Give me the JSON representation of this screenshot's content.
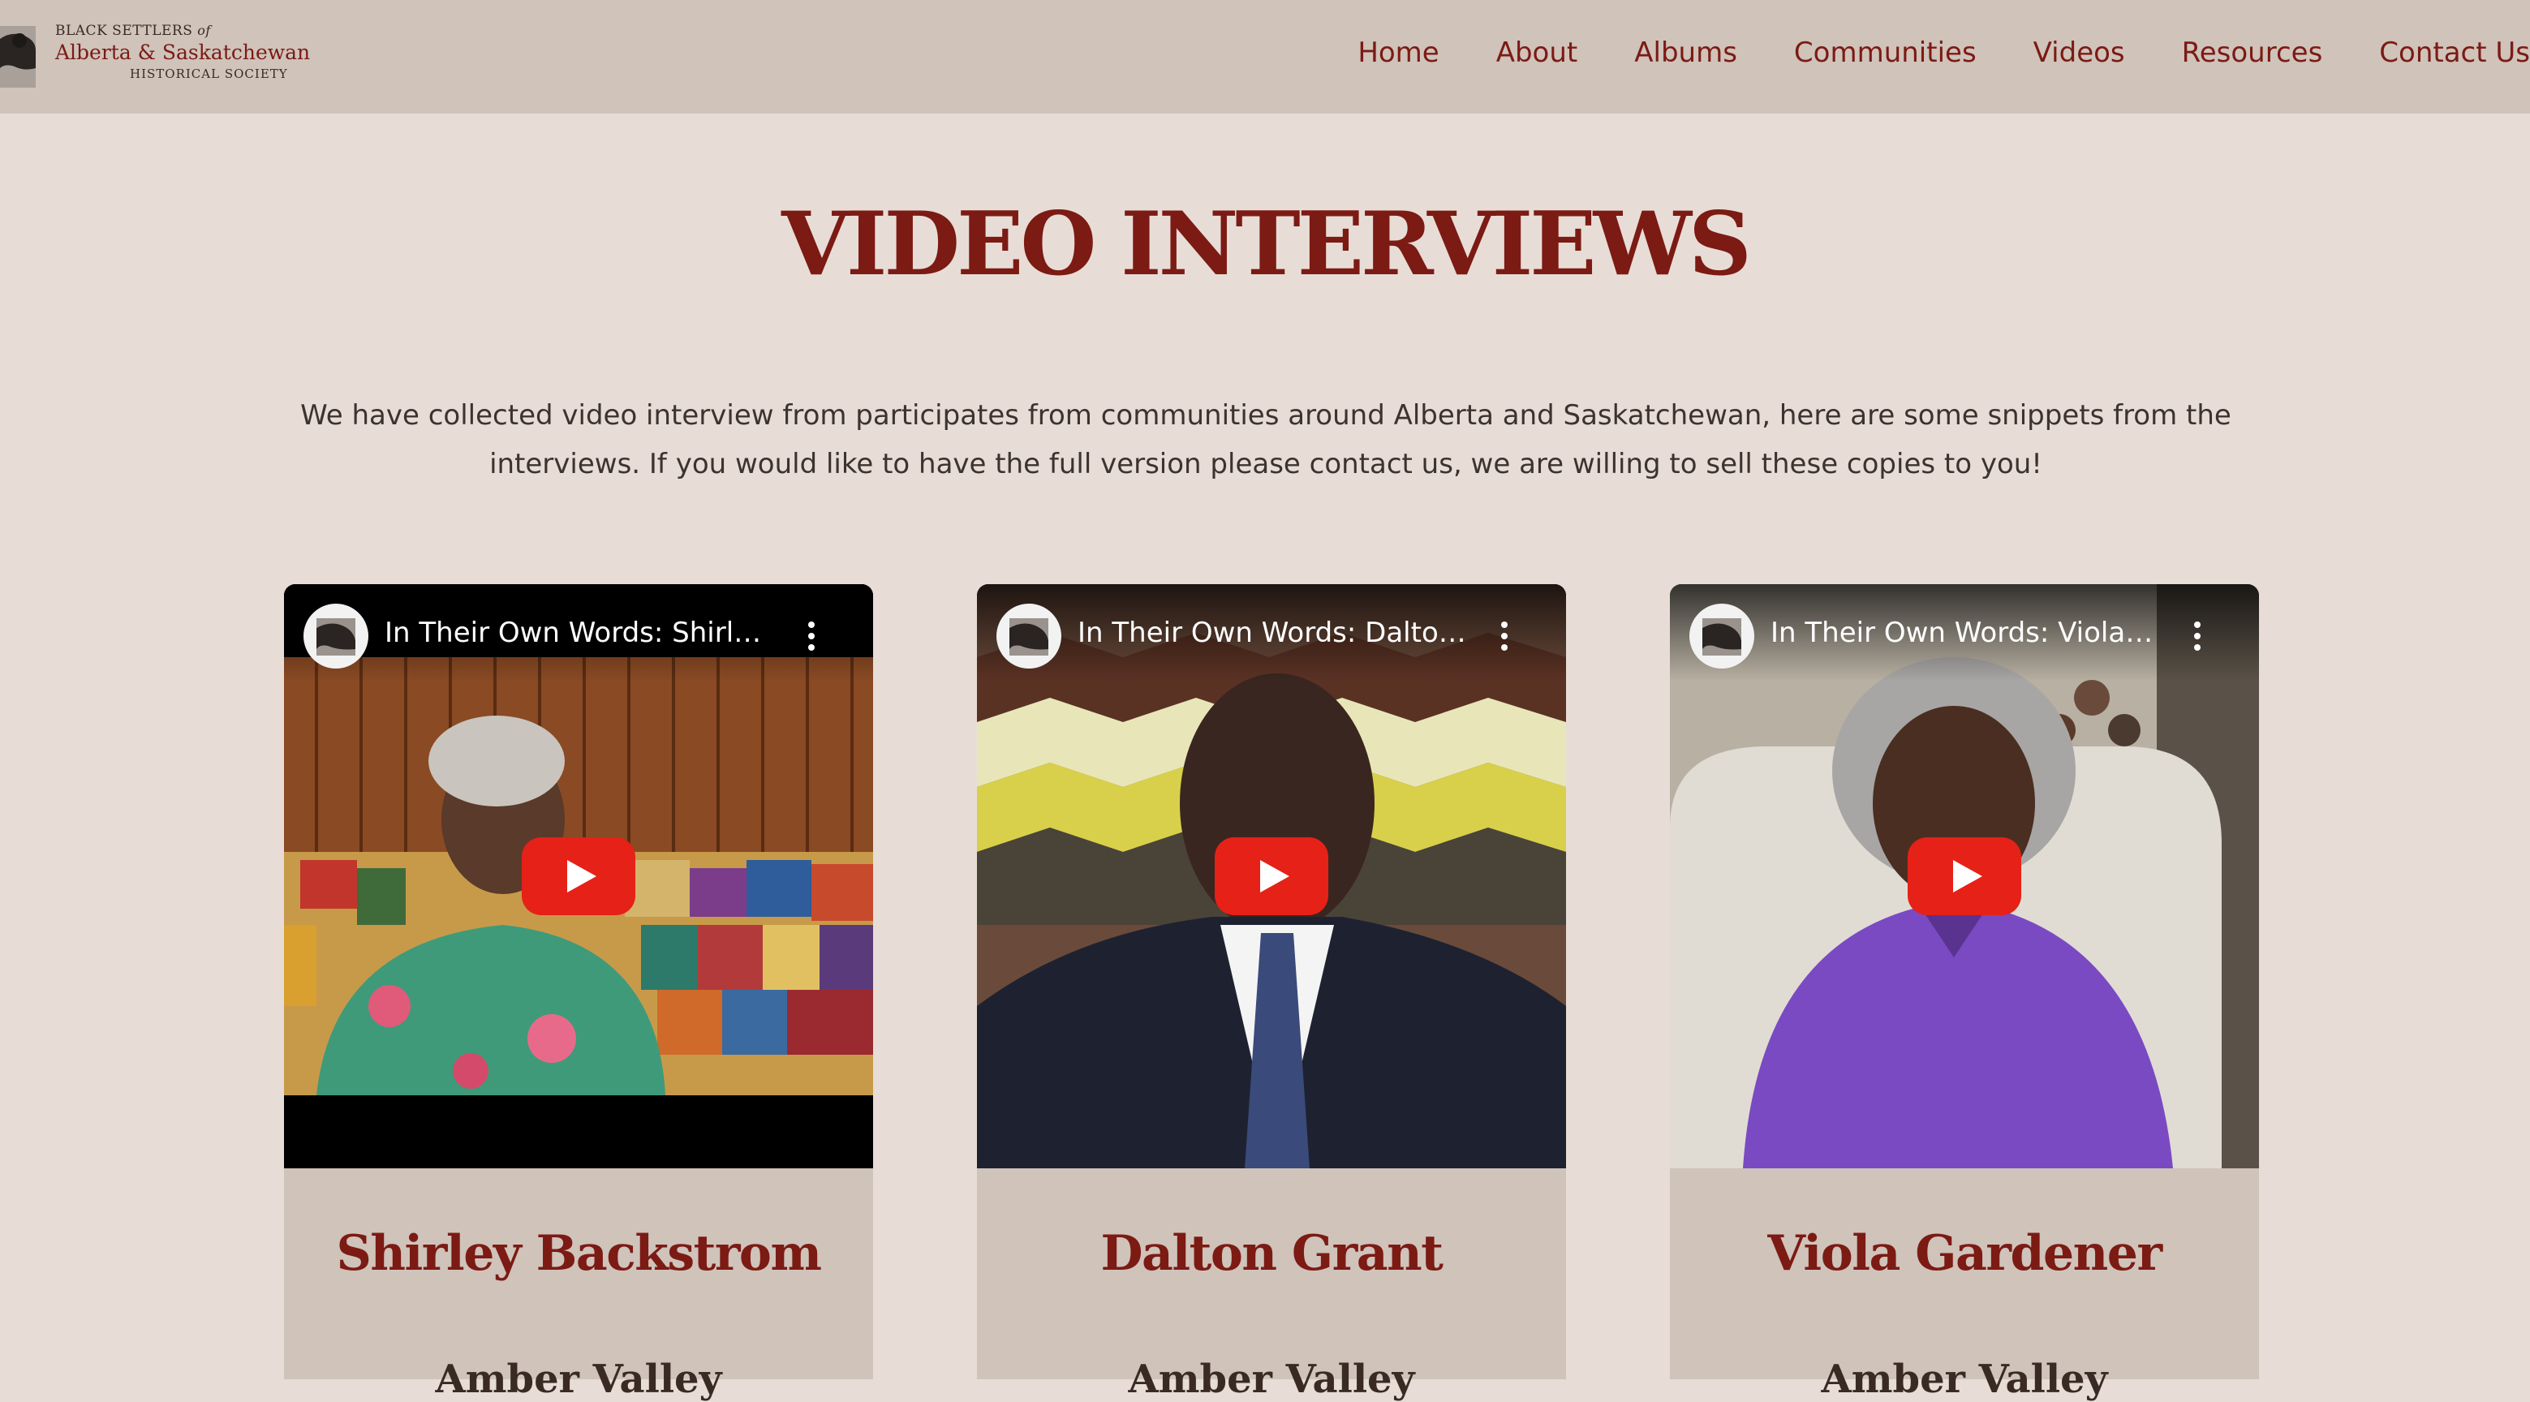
{
  "header": {
    "logo": {
      "line1": "BLACK SETTLERS",
      "line1_of": "of",
      "line2": "Alberta & Saskatchewan",
      "line3": "HISTORICAL SOCIETY"
    },
    "nav": [
      "Home",
      "About",
      "Albums",
      "Communities",
      "Videos",
      "Resources",
      "Contact Us"
    ]
  },
  "main": {
    "title": "VIDEO INTERVIEWS",
    "intro": "We have collected video interview from participates from communities around Alberta and Saskatchewan, here are some snippets from the interviews. If you would like to have the full version please contact us, we are willing to sell these copies to you!",
    "videos": [
      {
        "title": "In Their Own Words: Shirley ...",
        "name": "Shirley Backstrom",
        "sub": "Amber Valley"
      },
      {
        "title": "In Their Own Words: Dalton ...",
        "name": "Dalton Grant",
        "sub": "Amber Valley"
      },
      {
        "title": "In Their Own Words: Viola G...",
        "name": "Viola Gardener",
        "sub": "Amber Valley"
      }
    ]
  },
  "colors": {
    "brand": "#7c1a14",
    "header_bg": "#cfc3ba",
    "page_bg": "#e7ddd6",
    "play_red": "#e62117"
  },
  "icons": {
    "logo": "silhouette-logo-icon",
    "channel": "channel-avatar-icon",
    "menu": "kebab-menu-icon",
    "play": "youtube-play-icon"
  }
}
